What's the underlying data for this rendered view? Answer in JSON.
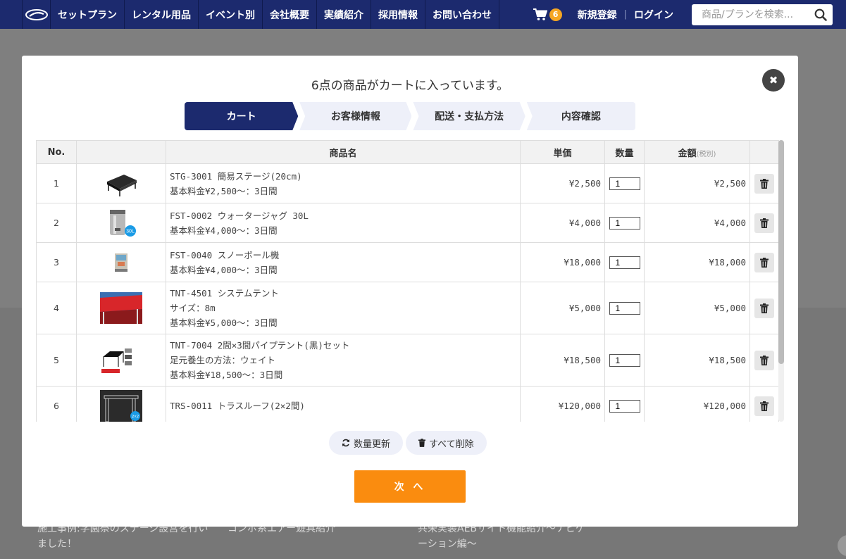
{
  "header": {
    "nav": [
      "セットプラン",
      "レンタル用品",
      "イベント別",
      "会社概要",
      "実績紹介",
      "採用情報",
      "お問い合わせ"
    ],
    "cart_count": "6",
    "register": "新規登録",
    "separator": "|",
    "login": "ログイン",
    "search_placeholder": "商品/プランを検索..."
  },
  "background": {
    "news": [
      "施工事例:学園祭のステージ設営を行いました！",
      "コンボ系エアー遊具紹介",
      "共栄実装AEBサイト機能紹介～ナビゲーション編～"
    ]
  },
  "modal": {
    "title": "6点の商品がカートに入っています。",
    "steps": [
      "カート",
      "お客様情報",
      "配送・支払方法",
      "内容確認"
    ],
    "active_step": 0,
    "columns": {
      "no": "No.",
      "name": "商品名",
      "unit_price": "単価",
      "qty": "数量",
      "amount": "金額",
      "amount_sub": "(税別)"
    },
    "rows": [
      {
        "no": "1",
        "lines": [
          "STG-3001 簡易ステージ(20cm)",
          "基本料金¥2,500～：3日間"
        ],
        "unit_price": "¥2,500",
        "qty": "1",
        "amount": "¥2,500",
        "thumb": "stage"
      },
      {
        "no": "2",
        "lines": [
          "FST-0002 ウォータージャグ 30L",
          "基本料金¥4,000～：3日間"
        ],
        "unit_price": "¥4,000",
        "qty": "1",
        "amount": "¥4,000",
        "thumb": "jug",
        "badge": "30L"
      },
      {
        "no": "3",
        "lines": [
          "FST-0040 スノーボール機",
          "基本料金¥4,000～：3日間"
        ],
        "unit_price": "¥18,000",
        "qty": "1",
        "amount": "¥18,000",
        "thumb": "snowball"
      },
      {
        "no": "4",
        "lines": [
          "TNT-4501 システムテント",
          "サイズ：8m",
          "基本料金¥5,000～：3日間"
        ],
        "unit_price": "¥5,000",
        "qty": "1",
        "amount": "¥5,000",
        "thumb": "tent"
      },
      {
        "no": "5",
        "lines": [
          "TNT-7004 2間×3間パイプテント(黒)セット",
          "足元養生の方法：ウェイト",
          "基本料金¥18,500～：3日間"
        ],
        "unit_price": "¥18,500",
        "qty": "1",
        "amount": "¥18,500",
        "thumb": "pipetent"
      },
      {
        "no": "6",
        "lines": [
          "TRS-0011 トラスルーフ(2×2間)"
        ],
        "unit_price": "¥120,000",
        "qty": "1",
        "amount": "¥120,000",
        "thumb": "truss",
        "badge": "2×2"
      }
    ],
    "update_label": "数量更新",
    "delete_all_label": "すべて削除",
    "next_label": "次 へ"
  },
  "colors": {
    "nav_bg": "#1c2a6e",
    "accent": "#fa8c0f",
    "badge": "#f5a623"
  }
}
